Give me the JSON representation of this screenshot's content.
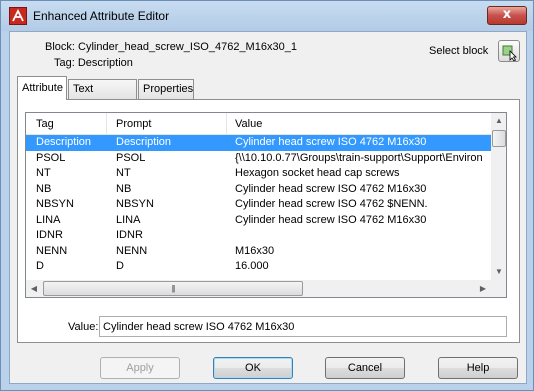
{
  "window": {
    "title": "Enhanced Attribute Editor",
    "close_label": "x"
  },
  "header": {
    "block_label": "Block: Cylinder_head_screw_ISO_4762_M16x30_1",
    "tag_label": "Tag: Description",
    "select_block_label": "Select block"
  },
  "tabs": [
    {
      "label": "Attribute",
      "active": true
    },
    {
      "label": "Text Options",
      "active": false
    },
    {
      "label": "Properties",
      "active": false
    }
  ],
  "table": {
    "columns": [
      "Tag",
      "Prompt",
      "Value"
    ],
    "rows": [
      {
        "tag": "Description",
        "prompt": "Description",
        "value": "Cylinder head screw ISO 4762 M16x30",
        "selected": true
      },
      {
        "tag": "PSOL",
        "prompt": "PSOL",
        "value": "{\\\\10.10.0.77\\Groups\\train-support\\Support\\Environ",
        "selected": false
      },
      {
        "tag": "NT",
        "prompt": "NT",
        "value": "Hexagon socket head cap screws",
        "selected": false
      },
      {
        "tag": "NB",
        "prompt": "NB",
        "value": "Cylinder head screw ISO 4762 M16x30",
        "selected": false
      },
      {
        "tag": "NBSYN",
        "prompt": "NBSYN",
        "value": "Cylinder head screw ISO 4762 $NENN.",
        "selected": false
      },
      {
        "tag": "LINA",
        "prompt": "LINA",
        "value": "Cylinder head screw ISO 4762 M16x30",
        "selected": false
      },
      {
        "tag": "IDNR",
        "prompt": "IDNR",
        "value": "",
        "selected": false
      },
      {
        "tag": "NENN",
        "prompt": "NENN",
        "value": "M16x30",
        "selected": false
      },
      {
        "tag": "D",
        "prompt": "D",
        "value": "16.000",
        "selected": false
      }
    ]
  },
  "value_field": {
    "label": "Value:",
    "value": "Cylinder head screw ISO 4762 M16x30"
  },
  "buttons": {
    "apply": "Apply",
    "ok": "OK",
    "cancel": "Cancel",
    "help": "Help"
  },
  "colors": {
    "selection": "#3399ff",
    "title_bar": "#b9d1ea",
    "close_button": "#c75050"
  }
}
